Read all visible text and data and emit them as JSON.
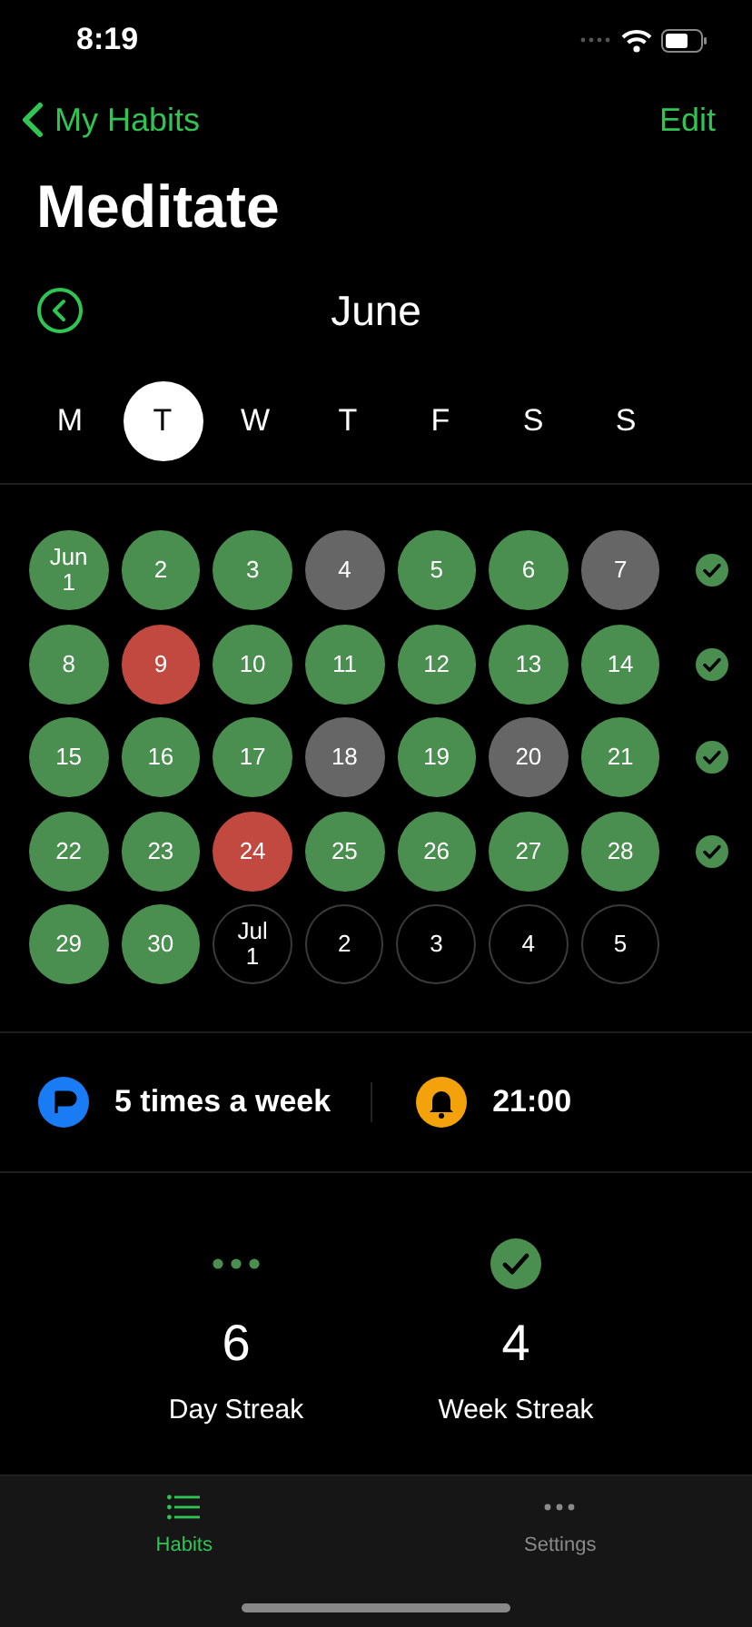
{
  "status_bar": {
    "time": "8:19"
  },
  "nav": {
    "back": "My Habits",
    "action": "Edit"
  },
  "title": "Meditate",
  "month": "June",
  "weekdays": [
    {
      "label": "M",
      "selected": false
    },
    {
      "label": "T",
      "selected": true
    },
    {
      "label": "W",
      "selected": false
    },
    {
      "label": "T",
      "selected": false
    },
    {
      "label": "F",
      "selected": false
    },
    {
      "label": "S",
      "selected": false
    },
    {
      "label": "S",
      "selected": false
    }
  ],
  "weeks": [
    {
      "completed": true,
      "days": [
        {
          "month": "Jun",
          "day": "1",
          "kind": "done"
        },
        {
          "day": "2",
          "kind": "done"
        },
        {
          "day": "3",
          "kind": "done"
        },
        {
          "day": "4",
          "kind": "skipped"
        },
        {
          "day": "5",
          "kind": "done"
        },
        {
          "day": "6",
          "kind": "done"
        },
        {
          "day": "7",
          "kind": "skipped"
        }
      ]
    },
    {
      "completed": true,
      "days": [
        {
          "day": "8",
          "kind": "done"
        },
        {
          "day": "9",
          "kind": "missed"
        },
        {
          "day": "10",
          "kind": "done"
        },
        {
          "day": "11",
          "kind": "done"
        },
        {
          "day": "12",
          "kind": "done"
        },
        {
          "day": "13",
          "kind": "done"
        },
        {
          "day": "14",
          "kind": "done"
        }
      ]
    },
    {
      "completed": true,
      "days": [
        {
          "day": "15",
          "kind": "done"
        },
        {
          "day": "16",
          "kind": "done"
        },
        {
          "day": "17",
          "kind": "done"
        },
        {
          "day": "18",
          "kind": "skipped"
        },
        {
          "day": "19",
          "kind": "done"
        },
        {
          "day": "20",
          "kind": "skipped"
        },
        {
          "day": "21",
          "kind": "done"
        }
      ]
    },
    {
      "completed": true,
      "days": [
        {
          "day": "22",
          "kind": "done"
        },
        {
          "day": "23",
          "kind": "done"
        },
        {
          "day": "24",
          "kind": "missed"
        },
        {
          "day": "25",
          "kind": "done"
        },
        {
          "day": "26",
          "kind": "done"
        },
        {
          "day": "27",
          "kind": "done"
        },
        {
          "day": "28",
          "kind": "done"
        }
      ]
    },
    {
      "completed": false,
      "days": [
        {
          "day": "29",
          "kind": "done"
        },
        {
          "day": "30",
          "kind": "done"
        },
        {
          "month": "Jul",
          "day": "1",
          "kind": "future"
        },
        {
          "day": "2",
          "kind": "future"
        },
        {
          "day": "3",
          "kind": "future"
        },
        {
          "day": "4",
          "kind": "future"
        },
        {
          "day": "5",
          "kind": "future"
        }
      ]
    }
  ],
  "goal": "5 times a week",
  "reminder": "21:00",
  "streaks": [
    {
      "kind": "dots",
      "value": "6",
      "label": "Day Streak"
    },
    {
      "kind": "check",
      "value": "4",
      "label": "Week Streak"
    }
  ],
  "tabs": [
    {
      "label": "Habits",
      "selected": true,
      "kind": "list"
    },
    {
      "label": "Settings",
      "selected": false,
      "kind": "more"
    }
  ]
}
